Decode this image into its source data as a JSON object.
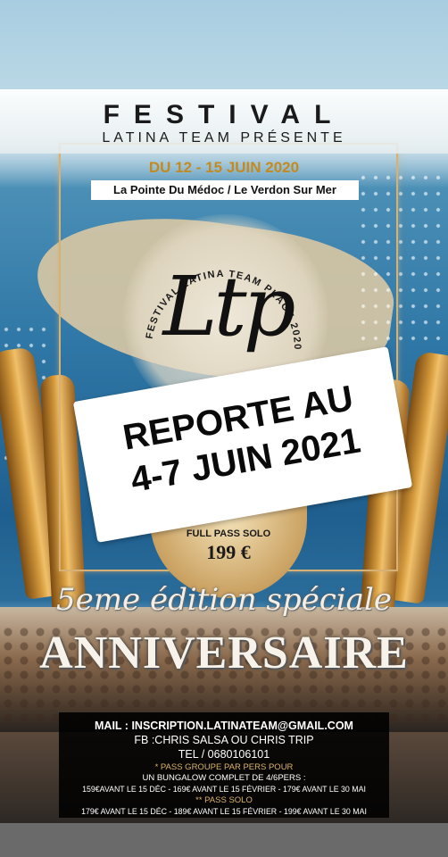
{
  "poster": {
    "festival_word": "FESTIVAL",
    "presenter": "LATINA TEAM PRÉSENTE",
    "dates": "DU 12 - 15 JUIN 2020",
    "location": "La Pointe Du Médoc / Le Verdon Sur Mer",
    "logo_initials": "Ltp",
    "logo_arc_text": "FESTIVAL LATINA TEAM PLAGE 2020",
    "pass_label": "FULL PASS SOLO",
    "pass_price": "199 €",
    "edition": "5eme édition spéciale",
    "anniversaire": "ANNIVERSAIRE"
  },
  "overlay": {
    "line1": "REPORTE AU",
    "line2": "4-7 JUIN 2021"
  },
  "info": {
    "mail": "MAIL : INSCRIPTION.LATINATEAM@GMAIL.COM",
    "fb": "FB :CHRIS SALSA OU CHRIS TRIP",
    "tel": "TEL / 0680106101",
    "pass_group_title": "* PASS GROUPE PAR PERS POUR",
    "bungalow": "UN BUNGALOW COMPLET DE 4/6PERS :",
    "group_prices": "159€AVANT LE 15 DÉC - 169€ AVANT LE 15 FÉVRIER - 179€ AVANT LE 30 MAI",
    "pass_solo_title": "** PASS SOLO",
    "solo_prices": "179€ AVANT LE 15 DÉC - 189€ AVANT LE 15 FÉVRIER - 199€ AVANT LE 30 MAI"
  },
  "colors": {
    "gold": "#c38a1f",
    "info_gold": "#d9b36a",
    "overlay_bg": "#ffffff"
  }
}
